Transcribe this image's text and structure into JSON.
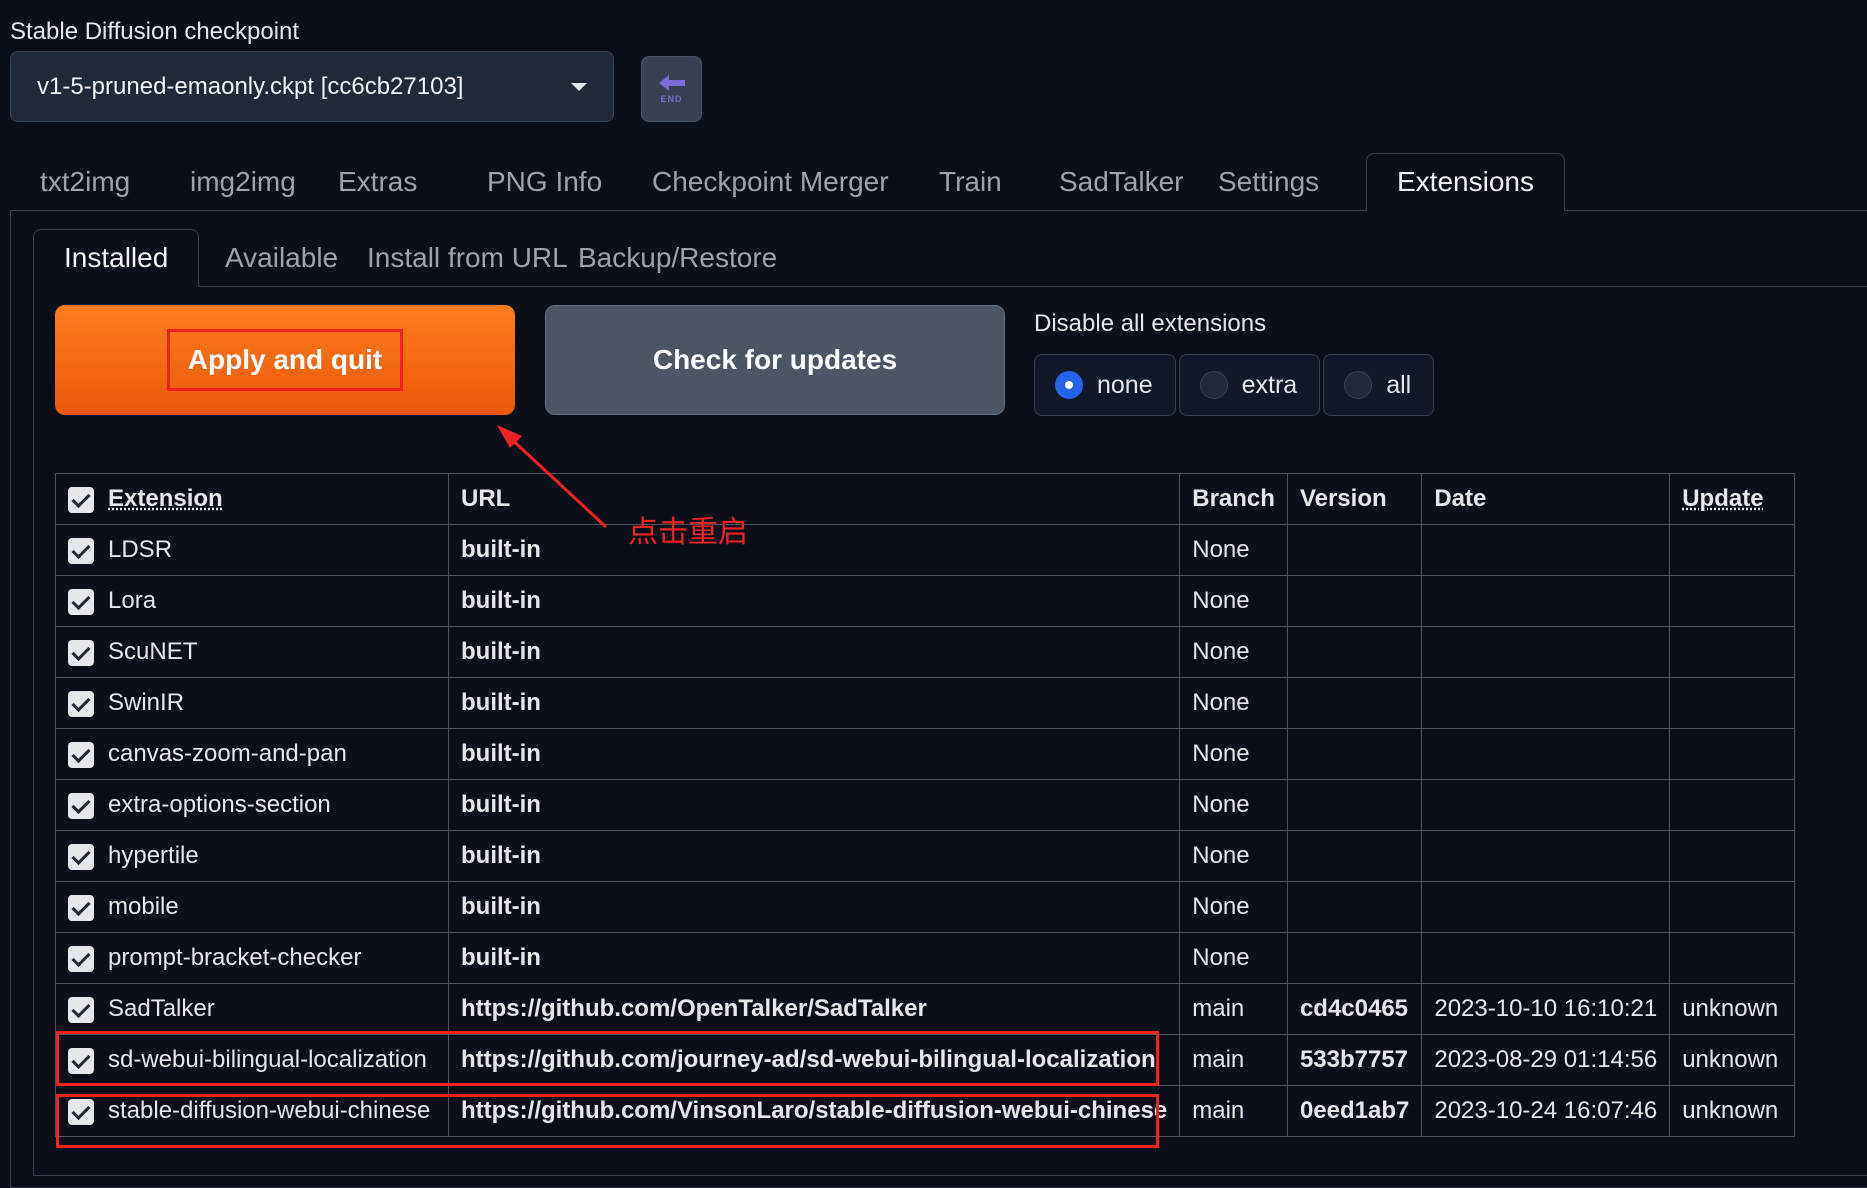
{
  "checkpoint": {
    "label": "Stable Diffusion checkpoint",
    "value": "v1-5-pruned-emaonly.ckpt [cc6cb27103]",
    "refresh_badge": "END"
  },
  "main_tabs": [
    "txt2img",
    "img2img",
    "Extras",
    "PNG Info",
    "Checkpoint Merger",
    "Train",
    "SadTalker",
    "Settings",
    "Extensions"
  ],
  "sub_tabs": [
    "Installed",
    "Available",
    "Install from URL",
    "Backup/Restore"
  ],
  "buttons": {
    "apply": "Apply and quit",
    "check": "Check for updates"
  },
  "disable": {
    "label": "Disable all extensions",
    "options": [
      "none",
      "extra",
      "all"
    ],
    "selected": "none"
  },
  "table": {
    "headers": [
      "Extension",
      "URL",
      "Branch",
      "Version",
      "Date",
      "Update"
    ],
    "rows": [
      {
        "name": "LDSR",
        "url": "built-in",
        "branch": "None",
        "version": "",
        "date": "",
        "update": ""
      },
      {
        "name": "Lora",
        "url": "built-in",
        "branch": "None",
        "version": "",
        "date": "",
        "update": ""
      },
      {
        "name": "ScuNET",
        "url": "built-in",
        "branch": "None",
        "version": "",
        "date": "",
        "update": ""
      },
      {
        "name": "SwinIR",
        "url": "built-in",
        "branch": "None",
        "version": "",
        "date": "",
        "update": ""
      },
      {
        "name": "canvas-zoom-and-pan",
        "url": "built-in",
        "branch": "None",
        "version": "",
        "date": "",
        "update": ""
      },
      {
        "name": "extra-options-section",
        "url": "built-in",
        "branch": "None",
        "version": "",
        "date": "",
        "update": ""
      },
      {
        "name": "hypertile",
        "url": "built-in",
        "branch": "None",
        "version": "",
        "date": "",
        "update": ""
      },
      {
        "name": "mobile",
        "url": "built-in",
        "branch": "None",
        "version": "",
        "date": "",
        "update": ""
      },
      {
        "name": "prompt-bracket-checker",
        "url": "built-in",
        "branch": "None",
        "version": "",
        "date": "",
        "update": ""
      },
      {
        "name": "SadTalker",
        "url": "https://github.com/OpenTalker/SadTalker",
        "branch": "main",
        "version": "cd4c0465",
        "date": "2023-10-10 16:10:21",
        "update": "unknown"
      },
      {
        "name": "sd-webui-bilingual-localization",
        "url": "https://github.com/journey-ad/sd-webui-bilingual-localization",
        "branch": "main",
        "version": "533b7757",
        "date": "2023-08-29 01:14:56",
        "update": "unknown"
      },
      {
        "name": "stable-diffusion-webui-chinese",
        "url": "https://github.com/VinsonLaro/stable-diffusion-webui-chinese",
        "branch": "main",
        "version": "0eed1ab7",
        "date": "2023-10-24 16:07:46",
        "update": "unknown"
      }
    ]
  },
  "annotation": {
    "text": "点击重启"
  },
  "colors": {
    "background": "#0b0f19",
    "accent_orange": "#ea580c",
    "highlight_red": "#ef2222",
    "radio_blue": "#2563eb"
  }
}
